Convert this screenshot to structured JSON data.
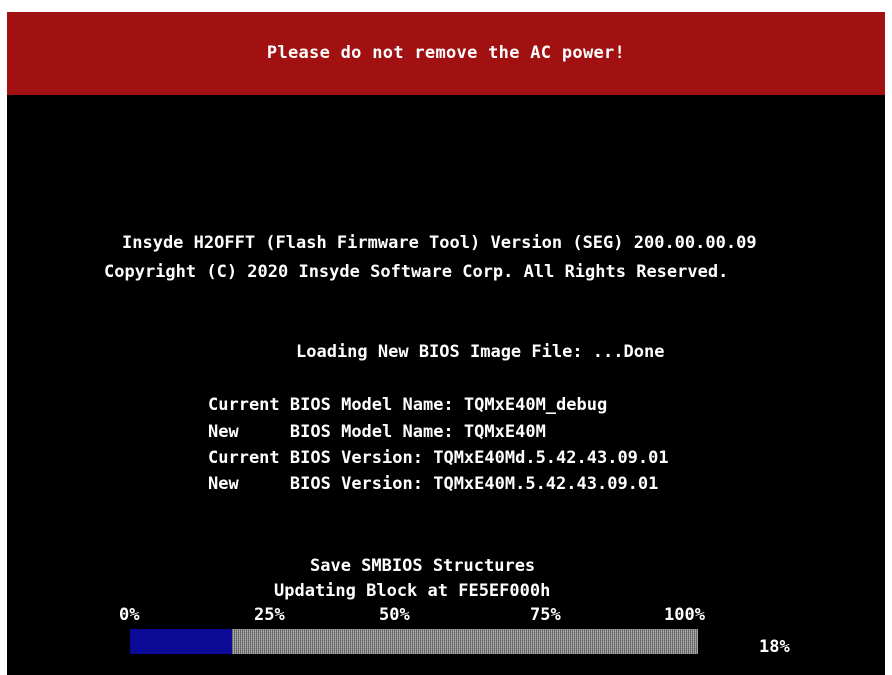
{
  "banner": {
    "text": "Please do not remove the AC power!",
    "color": "#a11111"
  },
  "tool": {
    "title": "Insyde H2OFFT (Flash Firmware Tool) Version (SEG) 200.00.00.09",
    "copyright": "Copyright (C) 2020 Insyde Software Corp. All Rights Reserved."
  },
  "loading": {
    "text": "Loading New BIOS Image File: ...Done"
  },
  "bios_info": [
    {
      "prefix": "Current",
      "label": "BIOS Model Name:",
      "value": "TQMxE40M_debug"
    },
    {
      "prefix": "New",
      "label": "BIOS Model Name:",
      "value": "TQMxE40M"
    },
    {
      "prefix": "Current",
      "label": "BIOS Version:",
      "value": "TQMxE40Md.5.42.43.09.01"
    },
    {
      "prefix": "New",
      "label": "BIOS Version:",
      "value": "TQMxE40M.5.42.43.09.01"
    }
  ],
  "status": {
    "line1": "Save SMBIOS Structures",
    "line2": "Updating Block at FE5EF000h"
  },
  "progress": {
    "ticks": [
      "0%",
      "25%",
      "50%",
      "75%",
      "100%"
    ],
    "percent_label": "18%",
    "fraction": 0.18,
    "fill_color": "#0a0a96"
  }
}
